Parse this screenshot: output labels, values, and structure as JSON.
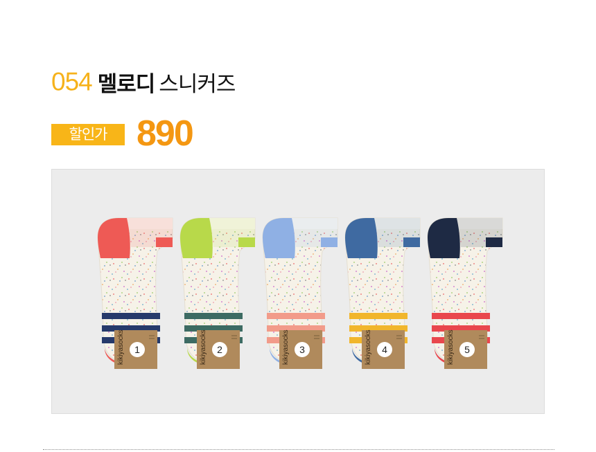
{
  "product": {
    "number": "054",
    "name_bold": "멜로디",
    "name_light": "스니커즈"
  },
  "price": {
    "badge_label": "할인가",
    "value": "890"
  },
  "photo": {
    "brand": "kikiyasocks",
    "socks": [
      {
        "label": "1",
        "heel": "#ee5a55",
        "stripe1": "#263a6b",
        "stripe2": "#263a6b",
        "toe": "#ee5a55"
      },
      {
        "label": "2",
        "heel": "#b8d94a",
        "stripe1": "#3d6b63",
        "stripe2": "#3d6b63",
        "toe": "#b8d94a"
      },
      {
        "label": "3",
        "heel": "#8fb0e4",
        "stripe1": "#f29b8a",
        "stripe2": "#f29b8a",
        "toe": "#8fb0e4"
      },
      {
        "label": "4",
        "heel": "#3f6aa1",
        "stripe1": "#f1b62c",
        "stripe2": "#f1b62c",
        "toe": "#3f6aa1"
      },
      {
        "label": "5",
        "heel": "#1e2a44",
        "stripe1": "#e9474d",
        "stripe2": "#e9474d",
        "toe": "#e9474d"
      }
    ]
  }
}
